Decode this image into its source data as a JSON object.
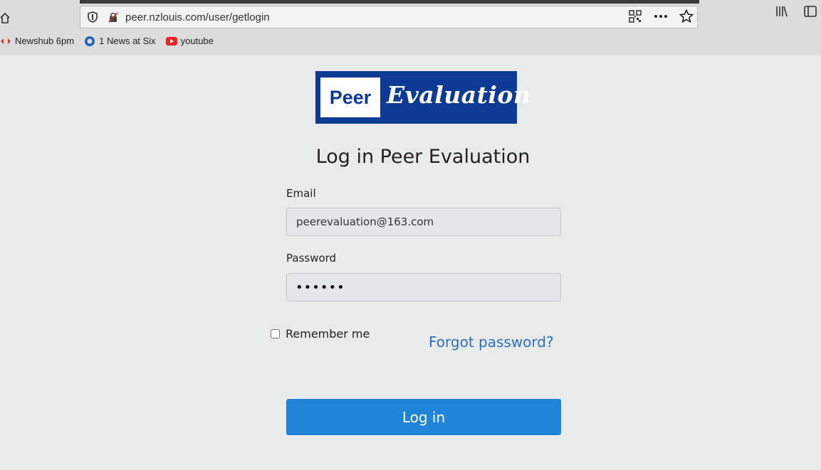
{
  "browser": {
    "url": "peer.nzlouis.com/user/getlogin",
    "bookmarks": [
      {
        "label": "Newshub 6pm",
        "icon": "newshub-icon"
      },
      {
        "label": "1 News at Six",
        "icon": "tvnz-icon"
      },
      {
        "label": "youtube",
        "icon": "youtube-icon"
      }
    ]
  },
  "logo": {
    "peer": "Peer",
    "evaluation": "Evaluation"
  },
  "login": {
    "title": "Log in Peer Evaluation",
    "email_label": "Email",
    "email_value": "peerevaluation@163.com",
    "password_label": "Password",
    "password_mask": "••••••",
    "remember_label": "Remember me",
    "forgot_label": "Forgot password?",
    "submit_label": "Log in"
  },
  "colors": {
    "brand": "#0d3a95",
    "button": "#1f83d8",
    "link": "#2a72b5"
  }
}
